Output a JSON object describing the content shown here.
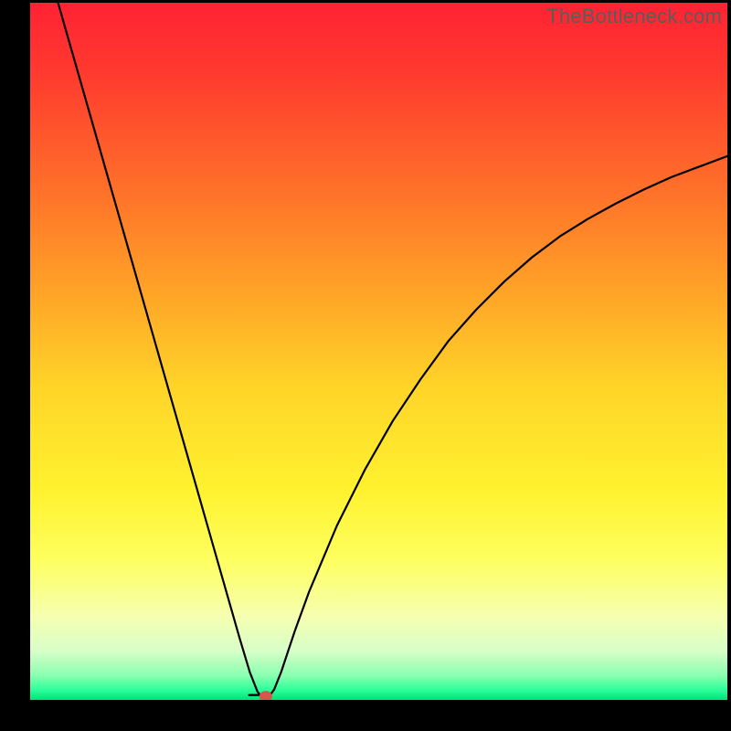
{
  "watermark": "TheBottleneck.com",
  "chart_data": {
    "type": "line",
    "title": "",
    "xlabel": "",
    "ylabel": "",
    "xlim": [
      0,
      100
    ],
    "ylim": [
      0,
      100
    ],
    "gradient_stops": [
      {
        "offset": 0.0,
        "color": "#ff2233"
      },
      {
        "offset": 0.1,
        "color": "#ff3a2f"
      },
      {
        "offset": 0.25,
        "color": "#ff6a2a"
      },
      {
        "offset": 0.4,
        "color": "#ff9e27"
      },
      {
        "offset": 0.55,
        "color": "#ffd428"
      },
      {
        "offset": 0.7,
        "color": "#fff22f"
      },
      {
        "offset": 0.8,
        "color": "#feff60"
      },
      {
        "offset": 0.88,
        "color": "#f6ffb0"
      },
      {
        "offset": 0.93,
        "color": "#d7ffc8"
      },
      {
        "offset": 0.965,
        "color": "#8affb0"
      },
      {
        "offset": 0.985,
        "color": "#2fff9a"
      },
      {
        "offset": 1.0,
        "color": "#00e37a"
      }
    ],
    "series": [
      {
        "name": "bottleneck-curve",
        "x": [
          4,
          6,
          8,
          10,
          12,
          14,
          16,
          18,
          20,
          22,
          24,
          26,
          28,
          30,
          31.5,
          32.6,
          33.2,
          34.2,
          35,
          36,
          38,
          40,
          44,
          48,
          52,
          56,
          60,
          64,
          68,
          72,
          76,
          80,
          84,
          88,
          92,
          96,
          100
        ],
        "y": [
          100,
          93,
          86,
          79,
          72,
          65,
          58,
          51,
          44,
          37,
          30,
          23,
          16,
          9,
          4,
          1.2,
          0.4,
          0.4,
          1.5,
          4,
          10,
          15.5,
          25,
          33,
          40,
          46,
          51.5,
          56,
          60,
          63.5,
          66.5,
          69,
          71.2,
          73.2,
          75,
          76.5,
          78
        ]
      }
    ],
    "marker": {
      "x": 33.8,
      "y": 0.5,
      "color": "#d2594b",
      "rx": 7,
      "ry": 6
    },
    "notch": {
      "x_start": 31.4,
      "x_end": 33.1,
      "y": 0.7
    }
  }
}
